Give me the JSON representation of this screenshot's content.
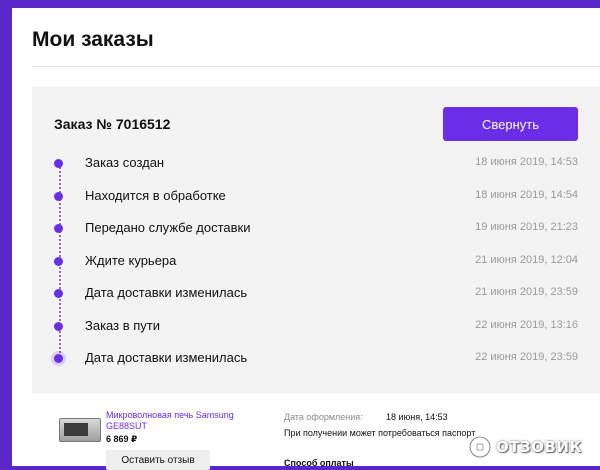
{
  "page": {
    "title": "Мои заказы"
  },
  "order": {
    "number_label": "Заказ № 7016512",
    "collapse_label": "Свернуть",
    "timeline": [
      {
        "status": "Заказ создан",
        "date": "18 июня 2019, 14:53"
      },
      {
        "status": "Находится в обработке",
        "date": "18 июня 2019, 14:54"
      },
      {
        "status": "Передано службе доставки",
        "date": "19 июня 2019, 21:23"
      },
      {
        "status": "Ждите курьера",
        "date": "21 июня 2019, 12:04"
      },
      {
        "status": "Дата доставки изменилась",
        "date": "21 июня 2019, 23:59"
      },
      {
        "status": "Заказ в пути",
        "date": "22 июня 2019, 13:16"
      },
      {
        "status": "Дата доставки изменилась",
        "date": "22 июня 2019, 23:59"
      }
    ]
  },
  "item": {
    "name": "Микроволновая печь Samsung GE88SUT",
    "price": "6 869 ₽",
    "review_label": "Оставить отзыв"
  },
  "details": {
    "date_label": "Дата оформления:",
    "date_value": "18 июня, 14:53",
    "note": "При получении может потребоваться паспорт",
    "payment_label": "Способ оплаты"
  },
  "watermark": {
    "text": "ОТЗОВИК"
  },
  "colors": {
    "accent": "#6a2ee8",
    "brand_bg": "#5a27c8"
  }
}
